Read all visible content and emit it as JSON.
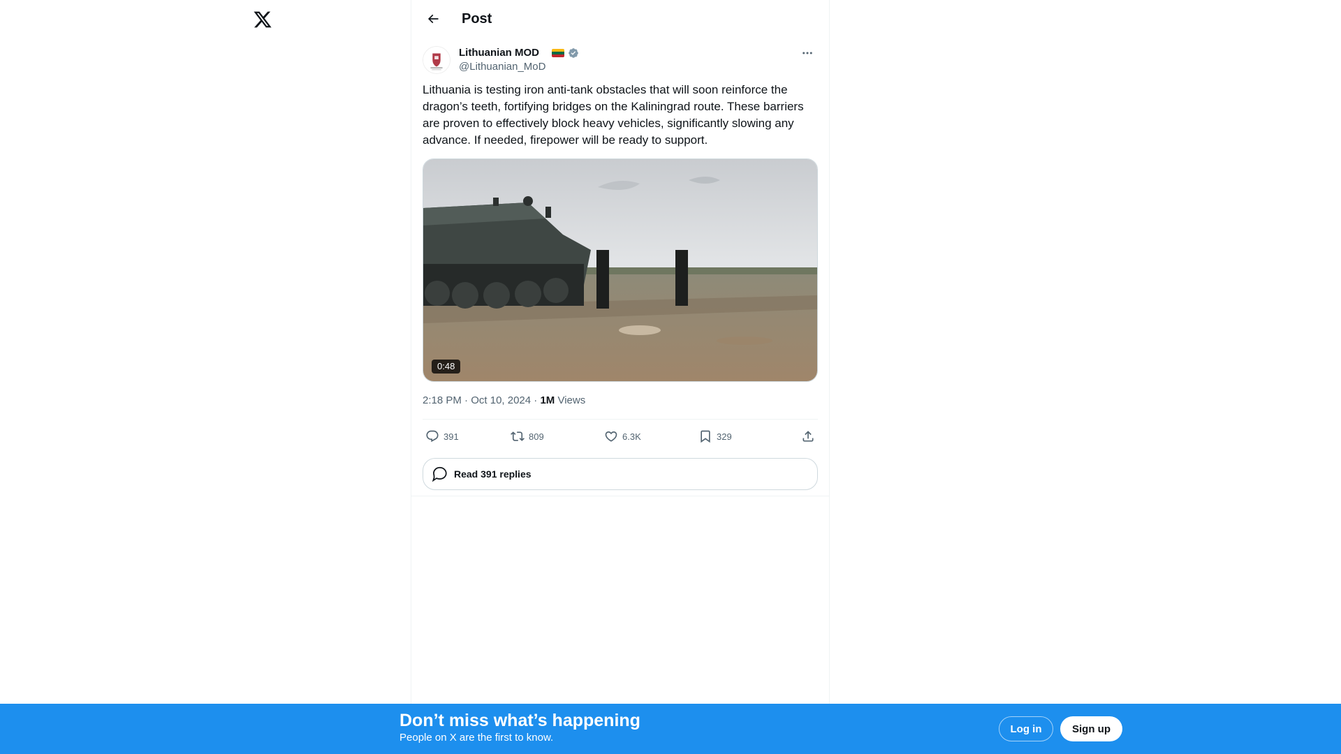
{
  "app": {
    "logo_icon": "x-logo-icon"
  },
  "header": {
    "title": "Post",
    "back_icon": "arrow-left-icon"
  },
  "post": {
    "author": {
      "display_name": "Lithuanian MOD",
      "handle": "@Lithuanian_MoD",
      "flag_icon": "lithuania-flag-icon",
      "verified_icon": "verified-badge-icon",
      "verified_color": "#829aab"
    },
    "text": "Lithuania is testing iron anti-tank obstacles that will soon reinforce the dragon’s teeth, fortifying bridges on the Kaliningrad route. These barriers are proven to effectively block heavy vehicles, significantly slowing any advance. If needed, firepower will be ready to support.",
    "media": {
      "type": "video",
      "duration": "0:48"
    },
    "meta": {
      "time": "2:18 PM",
      "separator": "·",
      "date": "Oct 10, 2024",
      "views_count": "1M",
      "views_label": "Views"
    },
    "actions": {
      "replies": "391",
      "reposts": "809",
      "likes": "6.3K",
      "bookmarks": "329"
    },
    "read_replies_label": "Read 391 replies"
  },
  "bottom_bar": {
    "title": "Don’t miss what’s happening",
    "subtitle": "People on X are the first to know.",
    "login_label": "Log in",
    "signup_label": "Sign up",
    "background_color": "#1d8fee"
  }
}
